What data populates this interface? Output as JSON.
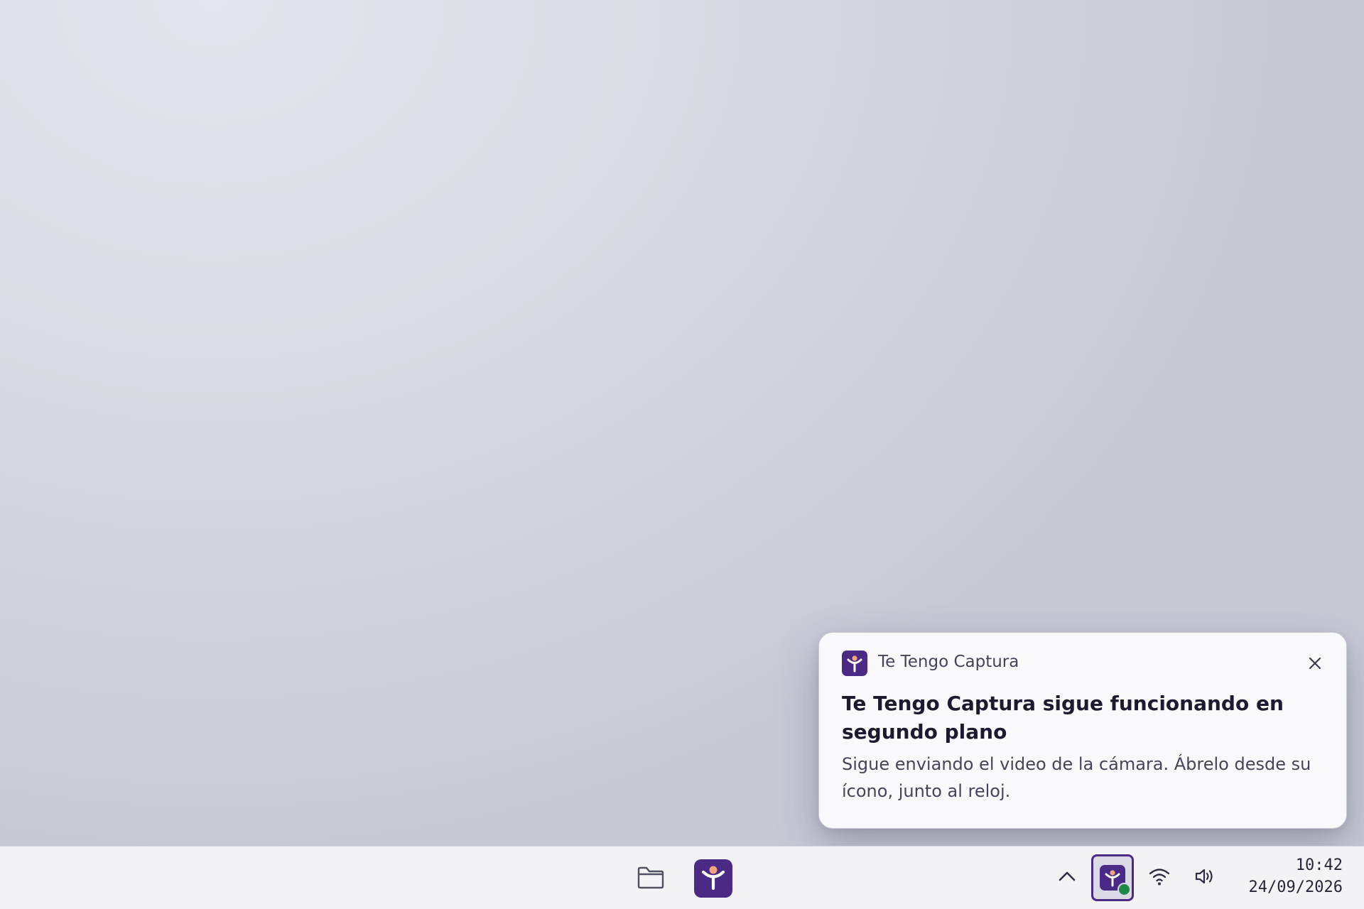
{
  "notification": {
    "app_name": "Te Tengo Captura",
    "title": "Te Tengo Captura sigue funcionando en segundo plano",
    "body": "Sigue enviando el video de la cámara. Ábrelo desde su ícono, junto al reloj."
  },
  "taskbar": {
    "pinned": [
      {
        "icon": "folder-icon"
      },
      {
        "icon": "te-tengo-captura-icon"
      }
    ],
    "tray": {
      "icons": [
        "chevron-up-icon",
        "te-tengo-captura-icon",
        "wifi-icon",
        "volume-icon"
      ],
      "app_status": "active"
    },
    "clock": {
      "time": "10:42",
      "date": "24/09/2026"
    }
  },
  "colors": {
    "brand": "#4b2a85",
    "accent_figure": "#f0a37c",
    "status_dot": "#1e8a4a"
  }
}
